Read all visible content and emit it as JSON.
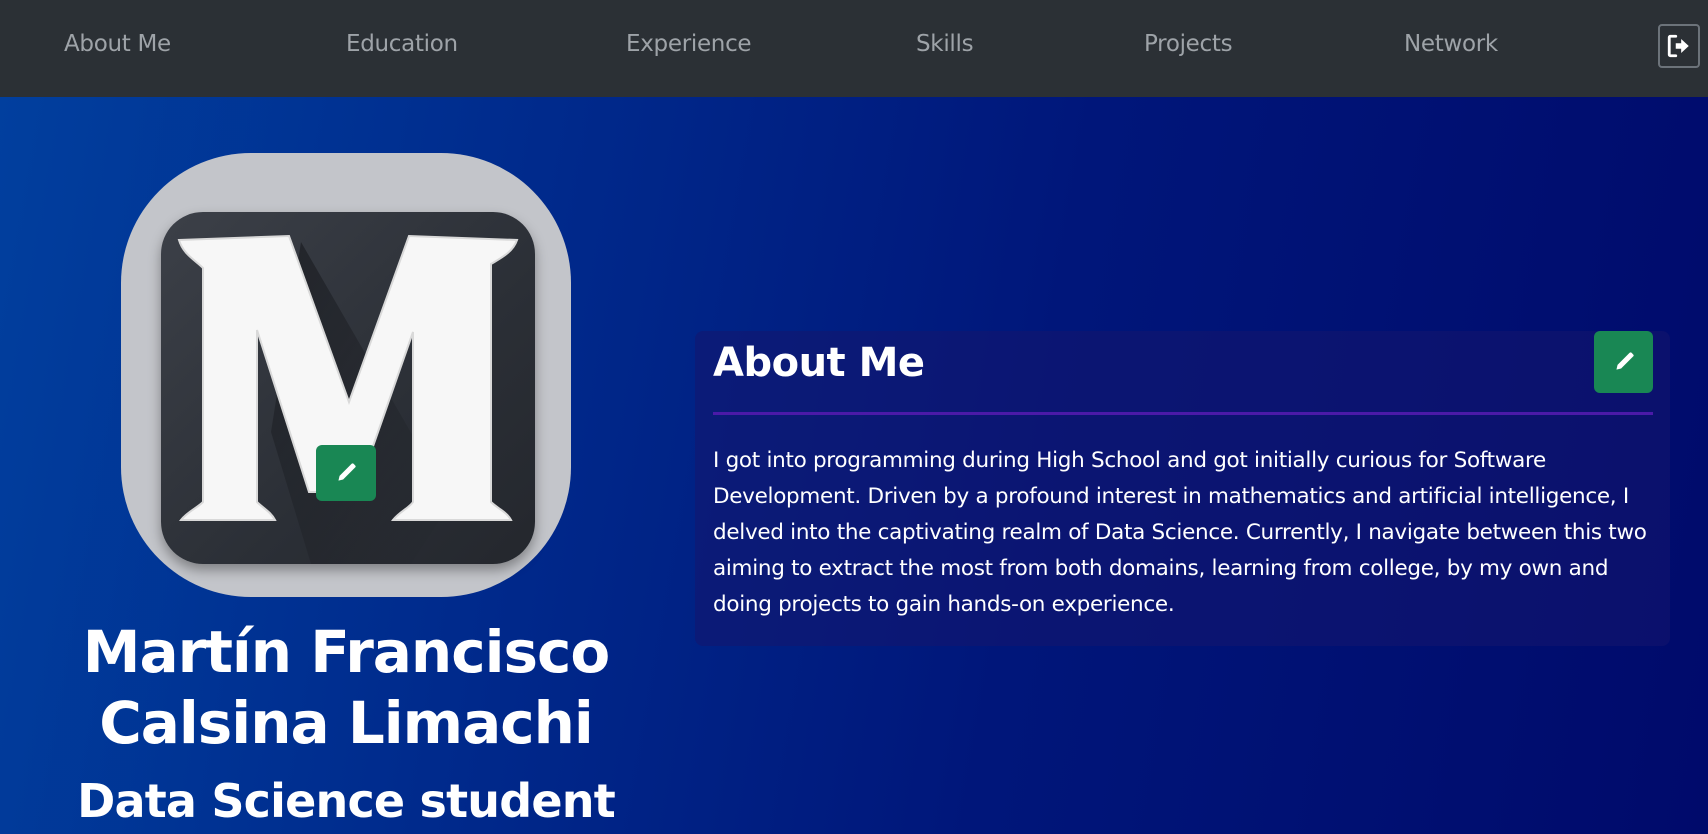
{
  "nav": {
    "items": [
      {
        "label": "About Me"
      },
      {
        "label": "Education"
      },
      {
        "label": "Experience"
      },
      {
        "label": "Skills"
      },
      {
        "label": "Projects"
      },
      {
        "label": "Network"
      }
    ],
    "logout_icon": "logout-icon"
  },
  "profile": {
    "avatar_letter": "M",
    "avatar_edit_icon": "pencil-icon",
    "name": "Martín Francisco Calsina Limachi",
    "subtitle": "Data Science student"
  },
  "about": {
    "title": "About Me",
    "edit_icon": "pencil-icon",
    "text": "I got into programming during High School and got initially curious for Software Development. Driven by a profound interest in mathematics and artificial intelligence, I delved into the captivating realm of Data Science. Currently, I navigate between this two aiming to extract the most from both domains, learning from college, by my own and doing projects to gain hands-on experience."
  },
  "colors": {
    "navbar": "#2b3035",
    "nav_text": "#9ea3a8",
    "edit_button": "#198754",
    "divider": "#4b1aa8",
    "hero_gradient_start": "#013f9e",
    "hero_gradient_end": "#000a6b"
  }
}
